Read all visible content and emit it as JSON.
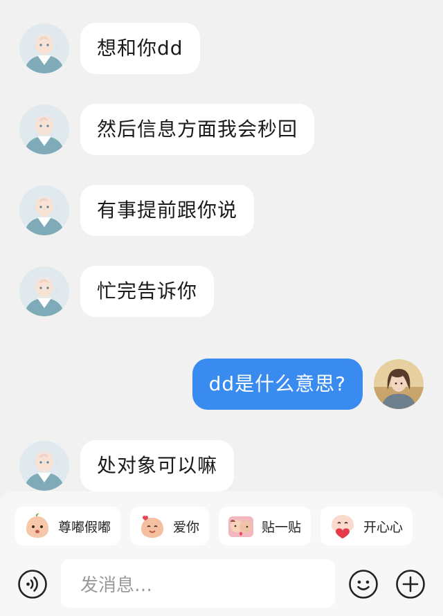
{
  "messages": [
    {
      "side": "in",
      "text": "想和你dd"
    },
    {
      "side": "in",
      "text": "然后信息方面我会秒回"
    },
    {
      "side": "in",
      "text": "有事提前跟你说"
    },
    {
      "side": "in",
      "text": "忙完告诉你"
    },
    {
      "side": "out",
      "text": "dd是什么意思?"
    },
    {
      "side": "in",
      "text": "处对象可以嘛"
    }
  ],
  "stickers": [
    {
      "label": "尊嘟假嘟",
      "icon": "peach-face-icon"
    },
    {
      "label": "爱你",
      "icon": "peach-love-icon"
    },
    {
      "label": "贴一贴",
      "icon": "hug-icon"
    },
    {
      "label": "开心心",
      "icon": "happy-heart-icon"
    }
  ],
  "input": {
    "placeholder": "发消息…"
  },
  "icons": {
    "voice": "voice-icon",
    "emoji": "emoji-icon",
    "plus": "plus-icon"
  },
  "colors": {
    "outgoing_bubble": "#3a8bf0",
    "incoming_bubble": "#ffffff",
    "background": "#f1f1f1"
  }
}
